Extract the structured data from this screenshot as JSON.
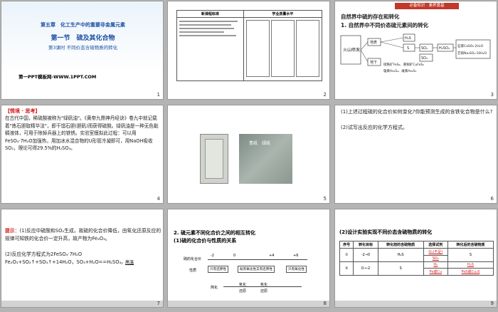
{
  "slides": [
    {
      "num": "1",
      "chapter": "第五章　化工生产中的重要非金属元素",
      "section": "第一节　硫及其化合物",
      "lesson": "第3课时 不同价态含硫物质的转化",
      "template": "第一PPT模板网-WWW.1PPT.COM"
    },
    {
      "num": "2",
      "col1": "新课程标准",
      "col2": "学业质量水平"
    },
    {
      "num": "3",
      "badge": "必备知识 · 素养奠基",
      "h1": "自然界中硫的存在和转化",
      "h2": "1. 自然界中不同价态硫元素间的转化",
      "nodes": [
        "火山喷发",
        "地表",
        "地下",
        "H₂S",
        "S",
        "SO₂",
        "SO₃",
        "H₂SO₄",
        "石膏CaSO₄·2H₂O",
        "芒硝Na₂SO₄·10H₂O",
        "硫铁矿FeS₂",
        "黄铜矿CuFeS₂",
        "雄黄As₄S₄",
        "雌黄As₂S₃"
      ]
    },
    {
      "num": "4",
      "tag": "【情境 · 思考】",
      "body": "在古代中国，稀硫酸被称为\"绿矾油\"。《黄帝九鼎神丹经诀》卷九中就记载着\"炼石胆取精华法\"，即干馏石胆(胆矾)而获得硫酸。绿矾油是一种无色黏稠液体，可用于除掉兵器上的铁锈。实验室模拟此过程：可以用FeSO₄·7H₂O加强热，用加冰水混合物的U形管冷凝即可，用NaOH吸收SO₂，理论可得29.5%的H₂SO₄。"
    },
    {
      "num": "5",
      "caption": "青矾　绿矾"
    },
    {
      "num": "6",
      "q1": "(1)上述过程硫的化合价如何变化?你能预测生成的含铁化合物是什么?",
      "q2": "(2)试写出反应的化学方程式。"
    },
    {
      "num": "7",
      "hint": "提示",
      "a1": "：(1)反应中硫酸和SO₂生成，故硫的化合价降低，由氧化还原反应的规律可知铁的化合价一定升高，故产物为Fe₂O₃。",
      "a2": "(2)反应化学方程式为2FeSO₄·7H₂O　　Fe₂O₃+SO₂↑+SO₃↑+14H₂O，SO₃+H₂O==H₂SO₄。",
      "cond": "高温"
    },
    {
      "num": "8",
      "h1": "2. 硫元素不同化合价之间的相互转化",
      "h2": "(1)硫的化合价与性质的关系",
      "row_label": "硫的化合价",
      "valences": [
        "-2",
        "0",
        "+4",
        "+6"
      ],
      "prop_label": "性质",
      "props": [
        "只有还原性",
        "既有氧化性又有还原性",
        "只有氧化性"
      ],
      "arrow1": "氧化",
      "arrow2": "还原",
      "note": "简化"
    },
    {
      "num": "9",
      "title": "(2)设计实验实现不同价态含硫物质的转化",
      "headers": [
        "序号",
        "转化目标",
        "转化前的含硫物质",
        "选择试剂",
        "转化后的含硫物质"
      ],
      "rows": [
        [
          "①",
          "-2→0",
          "H₂S",
          "O₂(不足)",
          "S"
        ],
        [
          "",
          "",
          "",
          "SO₂",
          ""
        ],
        [
          "②",
          "0→-2",
          "S",
          "H₂",
          "H₂S"
        ],
        [
          "",
          "",
          "",
          "Fe或Cu",
          "FeS或Cu₂S"
        ]
      ]
    }
  ],
  "colors": {
    "accent": "#1b4fa3",
    "red": "#d21c1c"
  }
}
